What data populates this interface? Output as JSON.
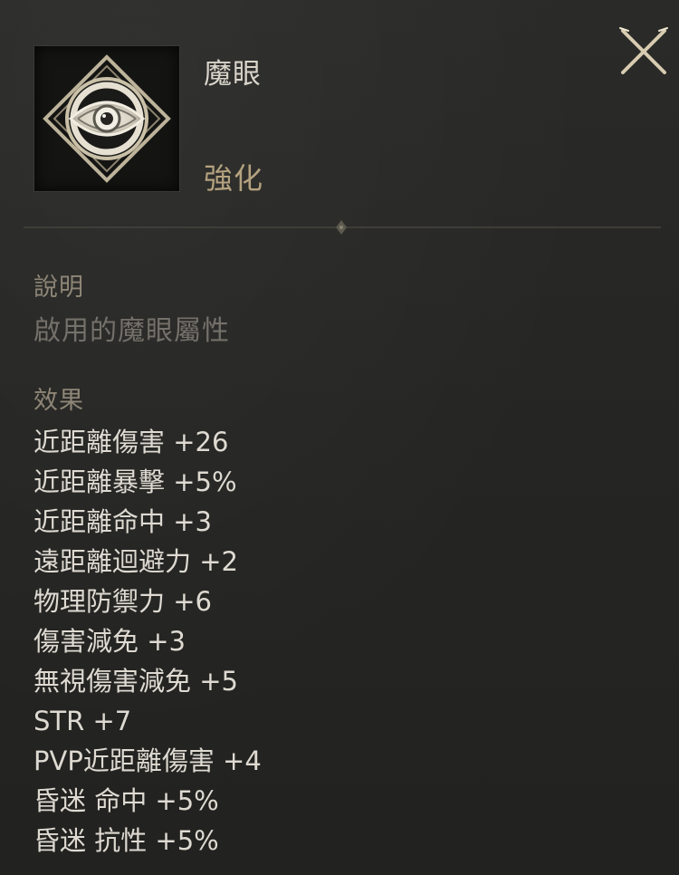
{
  "item": {
    "name": "魔眼",
    "category": "強化",
    "icon": "magic-eye-icon"
  },
  "close_icon": "close-x-icon",
  "description": {
    "label": "說明",
    "text": "啟用的魔眼屬性"
  },
  "effects": {
    "label": "效果",
    "list": [
      "近距離傷害 +26",
      "近距離暴擊 +5%",
      "近距離命中 +3",
      "遠距離迴避力 +2",
      "物理防禦力 +6",
      "傷害減免 +3",
      "無視傷害減免 +5",
      "STR +7",
      "PVP近距離傷害 +4",
      "昏迷 命中 +5%",
      "昏迷 抗性 +5%"
    ]
  },
  "colors": {
    "background": "#262624",
    "name": "#d9d5cb",
    "category_gold": "#b4a27f",
    "section_label": "#8e8677",
    "description": "#74706a",
    "effect_text": "#dedad2"
  }
}
